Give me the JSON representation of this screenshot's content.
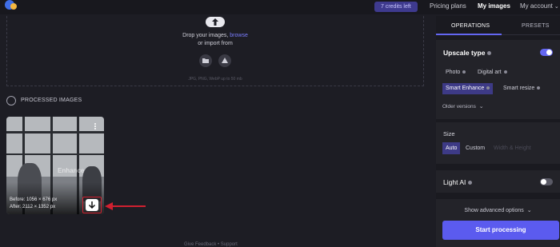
{
  "topbar": {
    "credits": "7 credits left",
    "nav": [
      "Pricing plans",
      "My images",
      "My account"
    ],
    "account_chevron": "⌄"
  },
  "upload": {
    "drop_prefix": "Drop your images, ",
    "browse": "browse",
    "or_import": "or import from",
    "import_sources": [
      "folder-icon",
      "google-drive-icon"
    ],
    "formats": "JPG, PNG, WebP up to 50 mb"
  },
  "processed": {
    "label": "PROCESSED IMAGES",
    "image": {
      "before": "Before: 1056 × 676 px",
      "after": "After: 2112 × 1352 px",
      "overlay_text": "Enhance"
    },
    "highlight_color": "#d02030"
  },
  "footer": {
    "feedback": "Give Feedback • Support"
  },
  "panel": {
    "tabs": [
      "OPERATIONS",
      "PRESETS"
    ],
    "active_tab": "OPERATIONS",
    "upscale": {
      "title": "Upscale type",
      "enabled": true,
      "options": [
        {
          "label": "Photo",
          "selected": false
        },
        {
          "label": "Digital art",
          "selected": false
        },
        {
          "label": "Smart Enhance",
          "selected": true
        },
        {
          "label": "Smart resize",
          "selected": false
        }
      ],
      "older_versions": "Older versions"
    },
    "size": {
      "title": "Size",
      "options": [
        "Auto",
        "Custom",
        "Width & Height"
      ],
      "selected": "Auto"
    },
    "light_ai": {
      "title": "Light AI",
      "enabled": false
    },
    "advanced": "Show advanced options",
    "start": "Start processing"
  },
  "colors": {
    "accent": "#6366f1",
    "button": "#5b5bef",
    "selected_option": "#3d3a86"
  }
}
